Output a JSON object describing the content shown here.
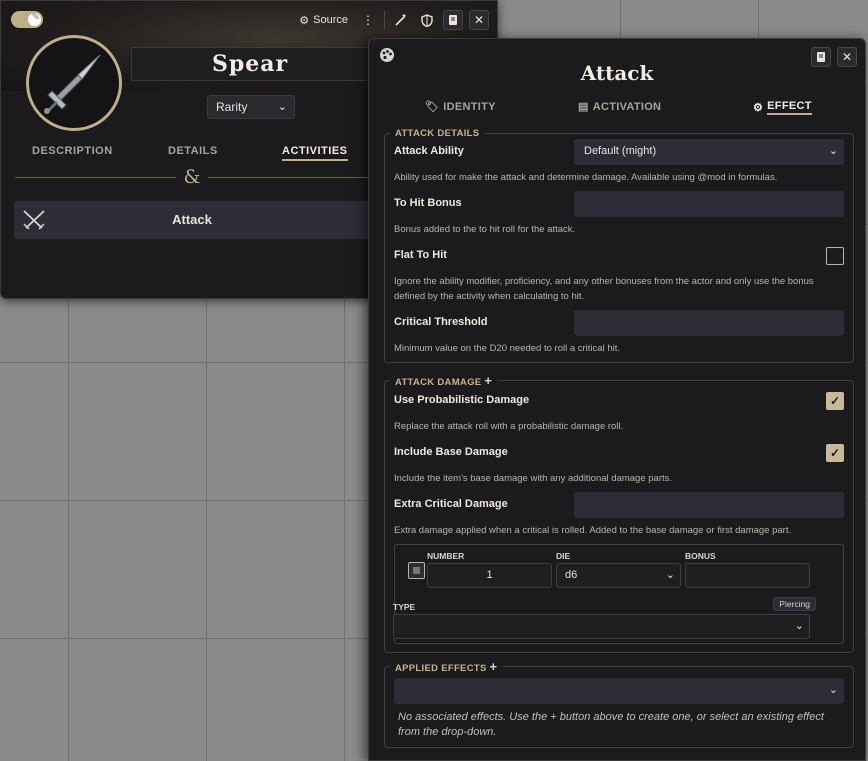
{
  "item_sheet": {
    "source_label": "Source",
    "name": "Spear",
    "rarity": "Rarity",
    "tabs": [
      {
        "label": "DESCRIPTION"
      },
      {
        "label": "DETAILS"
      },
      {
        "label": "ACTIVITIES",
        "active": true
      }
    ],
    "activities": [
      {
        "label": "Attack",
        "icon": "crossed-swords-icon"
      }
    ]
  },
  "activity_window": {
    "title": "Attack",
    "tabs": [
      {
        "label": "IDENTITY",
        "icon": "tag-icon"
      },
      {
        "label": "ACTIVATION",
        "icon": "clapperboard-icon"
      },
      {
        "label": "EFFECT",
        "icon": "gear-icon",
        "active": true
      }
    ],
    "attack_details": {
      "legend": "ATTACK DETAILS",
      "attack_ability": {
        "label": "Attack Ability",
        "value": "Default (might)",
        "hint": "Ability used for make the attack and determine damage. Available using @mod in formulas."
      },
      "to_hit_bonus": {
        "label": "To Hit Bonus",
        "value": "",
        "hint": "Bonus added to the to hit roll for the attack."
      },
      "flat_to_hit": {
        "label": "Flat To Hit",
        "checked": false,
        "hint": "Ignore the ability modifier, proficiency, and any other bonuses from the actor and only use the bonus defined by the activity when calculating to hit."
      },
      "critical_threshold": {
        "label": "Critical Threshold",
        "value": "",
        "hint": "Minimum value on the D20 needed to roll a critical hit."
      }
    },
    "attack_damage": {
      "legend": "ATTACK DAMAGE",
      "use_probabilistic": {
        "label": "Use Probabilistic Damage",
        "checked": true,
        "hint": "Replace the attack roll with a probabilistic damage roll."
      },
      "include_base": {
        "label": "Include Base Damage",
        "checked": true,
        "hint": "Include the item's base damage with any additional damage parts."
      },
      "extra_critical": {
        "label": "Extra Critical Damage",
        "value": "",
        "hint": "Extra damage applied when a critical is rolled. Added to the base damage or first damage part."
      },
      "damage_part": {
        "number_label": "NUMBER",
        "number_value": "1",
        "die_label": "DIE",
        "die_value": "d6",
        "bonus_label": "BONUS",
        "bonus_value": "",
        "type_label": "TYPE",
        "type_value": "",
        "type_tag": "Piercing"
      }
    },
    "applied_effects": {
      "legend": "APPLIED EFFECTS",
      "select_value": "",
      "note_before": "No associated effects. Use the",
      "note_after": "button above to create one, or select an existing effect from the drop-down."
    }
  },
  "colors": {
    "accent": "#bfae8a",
    "panel": "#1b1b1e",
    "field": "#2c2d36",
    "legend": "#c9b38c"
  }
}
